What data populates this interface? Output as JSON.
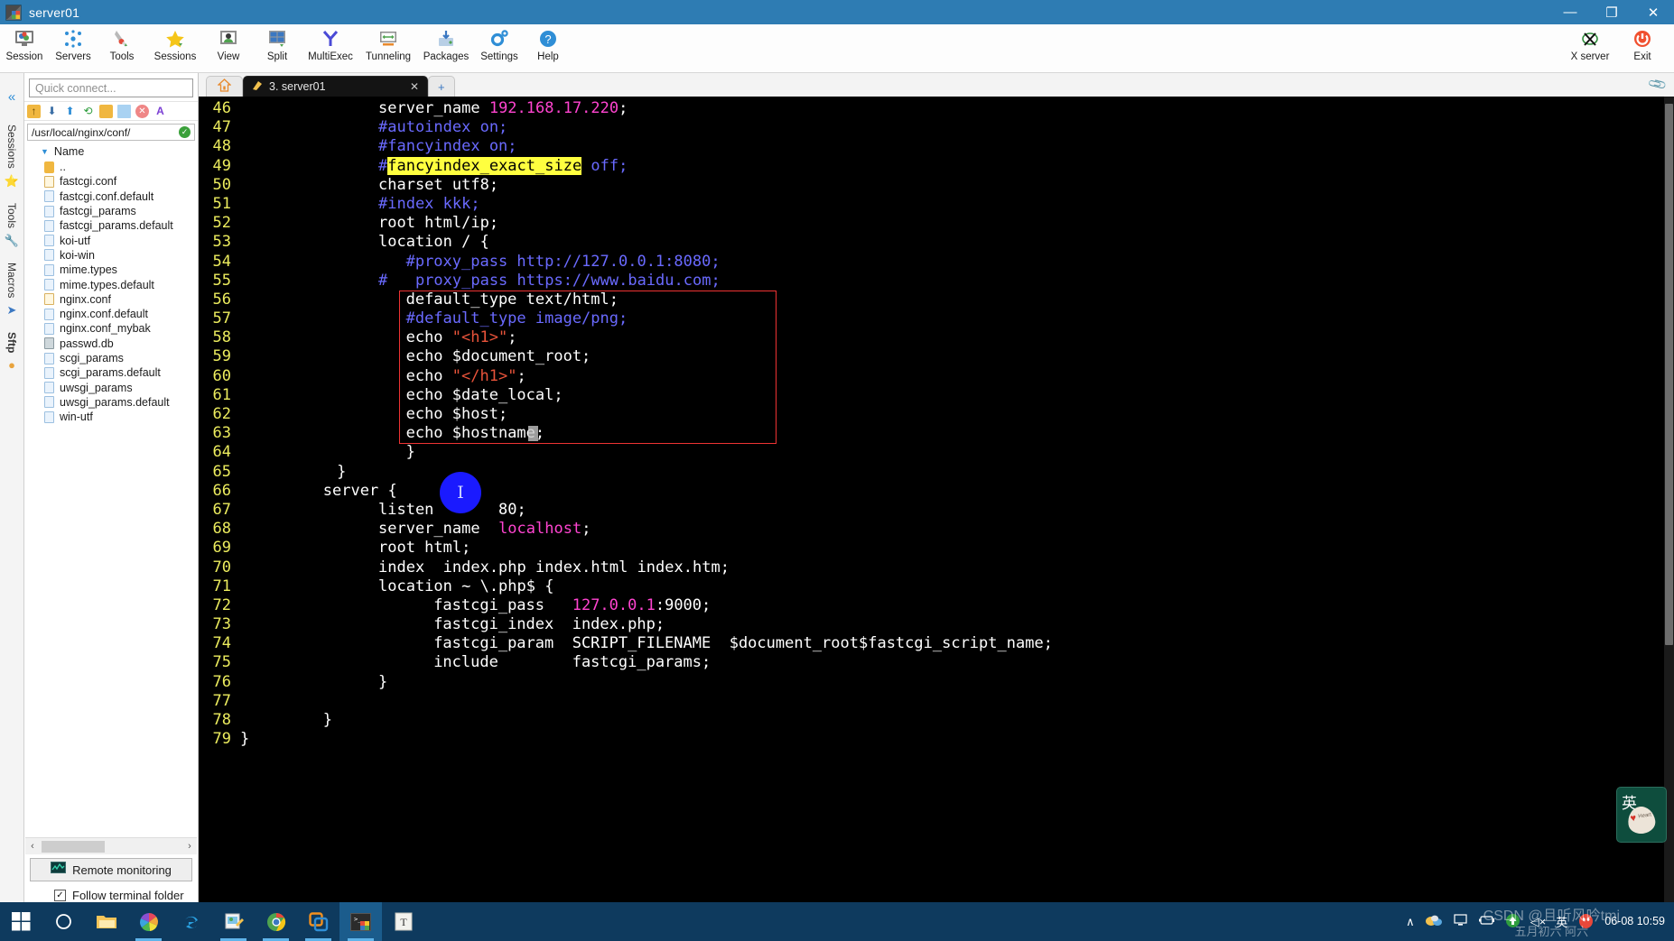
{
  "window": {
    "title": "server01",
    "icon": "mobaxterm-icon",
    "controls": {
      "minimize": "—",
      "maximize": "❐",
      "close": "✕"
    }
  },
  "ribbon": {
    "items": [
      {
        "label": "Session",
        "icon": "session-icon"
      },
      {
        "label": "Servers",
        "icon": "servers-icon"
      },
      {
        "label": "Tools",
        "icon": "tools-icon"
      },
      {
        "label": "Sessions",
        "icon": "sessions-star-icon"
      },
      {
        "label": "View",
        "icon": "view-icon"
      },
      {
        "label": "Split",
        "icon": "split-icon"
      },
      {
        "label": "MultiExec",
        "icon": "multiexec-icon"
      },
      {
        "label": "Tunneling",
        "icon": "tunneling-icon"
      },
      {
        "label": "Packages",
        "icon": "packages-icon"
      },
      {
        "label": "Settings",
        "icon": "settings-gear-icon"
      },
      {
        "label": "Help",
        "icon": "help-icon"
      }
    ],
    "right": [
      {
        "label": "X server",
        "icon": "xserver-icon"
      },
      {
        "label": "Exit",
        "icon": "power-icon"
      }
    ]
  },
  "vtabs": [
    {
      "label": "Sessions",
      "icon": "star-icon"
    },
    {
      "label": "Tools",
      "icon": "tools-icon"
    },
    {
      "label": "Macros",
      "icon": "macro-icon"
    },
    {
      "label": "Sftp",
      "icon": "sftp-icon"
    }
  ],
  "sidebar": {
    "collapse_icon": "double-chevron-left-icon",
    "quick_connect_placeholder": "Quick connect...",
    "toolbar_icons": [
      "parent-folder-icon",
      "download-icon",
      "upload-icon",
      "refresh-icon",
      "new-folder-icon",
      "new-file-icon",
      "delete-icon",
      "text-mode-icon"
    ],
    "path": "/usr/local/nginx/conf/",
    "path_status": "✓",
    "column_header": "Name",
    "sort_icon": "sort-descending-icon",
    "files": [
      {
        "name": "..",
        "type": "up"
      },
      {
        "name": "fastcgi.conf",
        "type": "edit"
      },
      {
        "name": "fastcgi.conf.default",
        "type": "file"
      },
      {
        "name": "fastcgi_params",
        "type": "file"
      },
      {
        "name": "fastcgi_params.default",
        "type": "file"
      },
      {
        "name": "koi-utf",
        "type": "file"
      },
      {
        "name": "koi-win",
        "type": "file"
      },
      {
        "name": "mime.types",
        "type": "file"
      },
      {
        "name": "mime.types.default",
        "type": "file"
      },
      {
        "name": "nginx.conf",
        "type": "edit"
      },
      {
        "name": "nginx.conf.default",
        "type": "file"
      },
      {
        "name": "nginx.conf_mybak",
        "type": "file"
      },
      {
        "name": "passwd.db",
        "type": "db"
      },
      {
        "name": "scgi_params",
        "type": "file"
      },
      {
        "name": "scgi_params.default",
        "type": "file"
      },
      {
        "name": "uwsgi_params",
        "type": "file"
      },
      {
        "name": "uwsgi_params.default",
        "type": "file"
      },
      {
        "name": "win-utf",
        "type": "file"
      }
    ],
    "scroll_left": "‹",
    "scroll_right": "›",
    "remote_monitoring": "Remote monitoring",
    "follow_terminal_folder": "Follow terminal folder",
    "follow_checked": "✓"
  },
  "tabs": {
    "home_icon": "home-icon",
    "session_tab": "3. server01",
    "session_tab_icon": "ssh-tab-icon",
    "close_icon": "✕",
    "new_tab_icon": "＋",
    "clip_icon": "paperclip-icon"
  },
  "terminal": {
    "first_line_number": 46,
    "cursor_line": 63,
    "lines": [
      {
        "n": 46,
        "indent": 10,
        "parts": [
          {
            "t": "server_name ",
            "c": "kw"
          },
          {
            "t": "192.168.17.220",
            "c": "num"
          },
          {
            "t": ";",
            "c": "kw"
          }
        ]
      },
      {
        "n": 47,
        "indent": 10,
        "parts": [
          {
            "t": "#autoindex on;",
            "c": "comment"
          }
        ]
      },
      {
        "n": 48,
        "indent": 10,
        "parts": [
          {
            "t": "#fancyindex on;",
            "c": "comment"
          }
        ]
      },
      {
        "n": 49,
        "indent": 10,
        "parts": [
          {
            "t": "#",
            "c": "comment"
          },
          {
            "t": "fancyindex_exact_size",
            "c": "hl"
          },
          {
            "t": " off;",
            "c": "comment"
          }
        ]
      },
      {
        "n": 50,
        "indent": 10,
        "parts": [
          {
            "t": "charset utf8;",
            "c": "kw"
          }
        ]
      },
      {
        "n": 51,
        "indent": 10,
        "parts": [
          {
            "t": "#index kkk;",
            "c": "comment"
          }
        ]
      },
      {
        "n": 52,
        "indent": 10,
        "parts": [
          {
            "t": "root html/ip;",
            "c": "kw"
          }
        ]
      },
      {
        "n": 53,
        "indent": 10,
        "parts": [
          {
            "t": "location / {",
            "c": "kw"
          }
        ]
      },
      {
        "n": 54,
        "indent": 12,
        "parts": [
          {
            "t": "#proxy_pass http://127.0.0.1:8080;",
            "c": "comment"
          }
        ]
      },
      {
        "n": 55,
        "indent": 10,
        "parts": [
          {
            "t": "#   proxy_pass https://www.baidu.com;",
            "c": "comment"
          }
        ]
      },
      {
        "n": 56,
        "indent": 12,
        "parts": [
          {
            "t": "default_type text/html;",
            "c": "kw"
          }
        ]
      },
      {
        "n": 57,
        "indent": 12,
        "parts": [
          {
            "t": "#default_type image/png;",
            "c": "comment"
          }
        ]
      },
      {
        "n": 58,
        "indent": 12,
        "parts": [
          {
            "t": "echo ",
            "c": "kw"
          },
          {
            "t": "\"<h1>\"",
            "c": "str"
          },
          {
            "t": ";",
            "c": "kw"
          }
        ]
      },
      {
        "n": 59,
        "indent": 12,
        "parts": [
          {
            "t": "echo $document_root;",
            "c": "kw"
          }
        ]
      },
      {
        "n": 60,
        "indent": 12,
        "parts": [
          {
            "t": "echo ",
            "c": "kw"
          },
          {
            "t": "\"</h1>\"",
            "c": "str"
          },
          {
            "t": ";",
            "c": "kw"
          }
        ]
      },
      {
        "n": 61,
        "indent": 12,
        "parts": [
          {
            "t": "echo $date_local;",
            "c": "kw"
          }
        ]
      },
      {
        "n": 62,
        "indent": 12,
        "parts": [
          {
            "t": "echo $host;",
            "c": "kw"
          }
        ]
      },
      {
        "n": 63,
        "indent": 12,
        "parts": [
          {
            "t": "echo $hostname;",
            "c": "kw"
          }
        ]
      },
      {
        "n": 64,
        "indent": 12,
        "parts": [
          {
            "t": "}",
            "c": "kw"
          }
        ]
      },
      {
        "n": 65,
        "indent": 7,
        "parts": [
          {
            "t": "}",
            "c": "kw"
          }
        ]
      },
      {
        "n": 66,
        "indent": 6,
        "parts": [
          {
            "t": "server {",
            "c": "kw"
          }
        ]
      },
      {
        "n": 67,
        "indent": 10,
        "parts": [
          {
            "t": "listen       80;",
            "c": "kw"
          }
        ]
      },
      {
        "n": 68,
        "indent": 10,
        "parts": [
          {
            "t": "server_name  ",
            "c": "kw"
          },
          {
            "t": "localhost",
            "c": "num"
          },
          {
            "t": ";",
            "c": "kw"
          }
        ]
      },
      {
        "n": 69,
        "indent": 10,
        "parts": [
          {
            "t": "root html;",
            "c": "kw"
          }
        ]
      },
      {
        "n": 70,
        "indent": 10,
        "parts": [
          {
            "t": "index  index.php index.html index.htm;",
            "c": "kw"
          }
        ]
      },
      {
        "n": 71,
        "indent": 10,
        "parts": [
          {
            "t": "location ~ \\.php$ {",
            "c": "kw"
          }
        ]
      },
      {
        "n": 72,
        "indent": 14,
        "parts": [
          {
            "t": "fastcgi_pass   ",
            "c": "kw"
          },
          {
            "t": "127.0.0.1",
            "c": "num"
          },
          {
            "t": ":9000;",
            "c": "kw"
          }
        ]
      },
      {
        "n": 73,
        "indent": 14,
        "parts": [
          {
            "t": "fastcgi_index  index.php;",
            "c": "kw"
          }
        ]
      },
      {
        "n": 74,
        "indent": 14,
        "parts": [
          {
            "t": "fastcgi_param  SCRIPT_FILENAME  $document_root$fastcgi_script_name;",
            "c": "kw"
          }
        ]
      },
      {
        "n": 75,
        "indent": 14,
        "parts": [
          {
            "t": "include        fastcgi_params;",
            "c": "kw"
          }
        ]
      },
      {
        "n": 76,
        "indent": 10,
        "parts": [
          {
            "t": "}",
            "c": "kw"
          }
        ]
      },
      {
        "n": 77,
        "indent": 0,
        "parts": [
          {
            "t": "",
            "c": "kw"
          }
        ]
      },
      {
        "n": 78,
        "indent": 6,
        "parts": [
          {
            "t": "}",
            "c": "kw"
          }
        ]
      },
      {
        "n": 79,
        "indent": 0,
        "parts": [
          {
            "t": "}",
            "c": "kw"
          }
        ]
      }
    ],
    "colors": {
      "background": "#000000",
      "line_number": "#ecec5e",
      "text": "#e8e8e8",
      "comment": "#6a6aff",
      "number": "#ff44d0",
      "string": "#e8533a",
      "highlight_bg": "#ffff3f",
      "selection_box": "#ee3333"
    }
  },
  "ime": {
    "label": "英",
    "tooltip": "Heart"
  },
  "taskbar": {
    "buttons": [
      {
        "name": "start-button",
        "icon": "windows-logo-icon",
        "running": false
      },
      {
        "name": "cortana-search",
        "icon": "circle-icon",
        "running": false
      },
      {
        "name": "file-explorer",
        "icon": "folder-icon",
        "running": false
      },
      {
        "name": "photos-app",
        "icon": "pinwheel-icon",
        "running": true
      },
      {
        "name": "microsoft-edge",
        "icon": "edge-icon",
        "running": false
      },
      {
        "name": "snipping-tool",
        "icon": "snip-icon",
        "running": true
      },
      {
        "name": "google-chrome",
        "icon": "chrome-icon",
        "running": true
      },
      {
        "name": "vmware-workstation",
        "icon": "vmware-icon",
        "running": true
      },
      {
        "name": "mobaxterm",
        "icon": "mobaxterm-icon",
        "running": true,
        "active": true
      },
      {
        "name": "typora",
        "icon": "typora-icon",
        "running": false
      }
    ],
    "tray": [
      {
        "name": "show-hidden-icons",
        "icon": "∧"
      },
      {
        "name": "onedrive-icon",
        "icon": "cloud-icon"
      },
      {
        "name": "network-icon",
        "icon": "monitor-icon"
      },
      {
        "name": "battery-icon",
        "icon": "battery-icon"
      },
      {
        "name": "update-icon",
        "icon": "arrow-up-circle-icon"
      },
      {
        "name": "volume-icon",
        "icon": "◁×"
      },
      {
        "name": "ime-language",
        "icon": "英"
      },
      {
        "name": "qq-icon",
        "icon": "penguin-icon"
      }
    ],
    "clock": {
      "date": "06-08",
      "time": "10:59"
    },
    "watermark": {
      "main": "CSDN @且听风吟tmj",
      "sub": "五月初六 阿六"
    }
  }
}
